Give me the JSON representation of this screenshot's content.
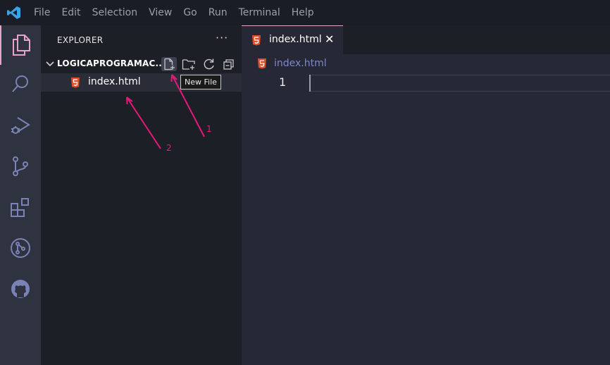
{
  "menu": {
    "items": [
      "File",
      "Edit",
      "Selection",
      "View",
      "Go",
      "Run",
      "Terminal",
      "Help"
    ]
  },
  "activity_bar": {
    "icons": [
      "files-icon",
      "search-icon",
      "run-debug-icon",
      "source-control-icon",
      "extensions-icon",
      "git-graph-icon",
      "github-icon"
    ]
  },
  "explorer": {
    "title": "EXPLORER",
    "more": "···",
    "folder_name": "LOGICAPROGRAMAC...",
    "files": [
      {
        "name": "index.html"
      }
    ],
    "tooltip": "New File"
  },
  "editor": {
    "tab_label": "index.html",
    "tab_close": "✕",
    "breadcrumb": "index.html",
    "line_numbers": [
      "1"
    ]
  },
  "annotations": {
    "label_1": "1",
    "label_2": "2"
  },
  "colors": {
    "accent_pink": "#e8187a",
    "html_icon": "#e44d26",
    "breadcrumb": "#7e87c9",
    "vscode_blue": "#3ca2e6"
  }
}
